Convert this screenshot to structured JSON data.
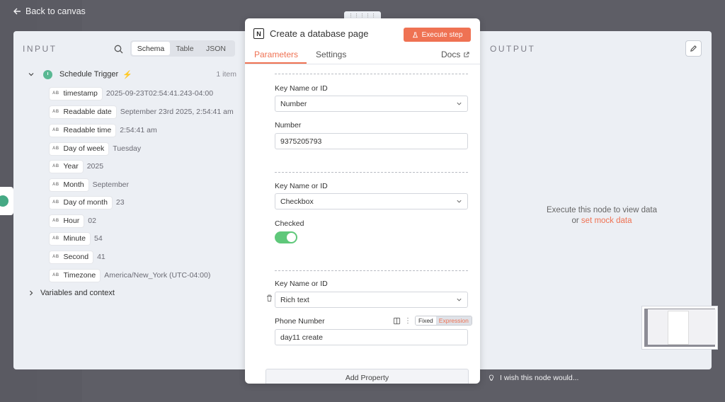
{
  "nav": {
    "back_label": "Back to canvas"
  },
  "input_panel": {
    "title": "INPUT",
    "tabs": [
      {
        "label": "Schema",
        "active": true
      },
      {
        "label": "Table",
        "active": false
      },
      {
        "label": "JSON",
        "active": false
      }
    ],
    "trigger": {
      "name": "Schedule Trigger",
      "count": "1 item"
    },
    "fields": [
      {
        "type": "AB",
        "name": "timestamp",
        "value": "2025-09-23T02:54:41.243-04:00"
      },
      {
        "type": "AB",
        "name": "Readable date",
        "value": "September 23rd 2025, 2:54:41 am"
      },
      {
        "type": "AB",
        "name": "Readable time",
        "value": "2:54:41 am"
      },
      {
        "type": "AB",
        "name": "Day of week",
        "value": "Tuesday"
      },
      {
        "type": "AB",
        "name": "Year",
        "value": "2025"
      },
      {
        "type": "AB",
        "name": "Month",
        "value": "September"
      },
      {
        "type": "AB",
        "name": "Day of month",
        "value": "23"
      },
      {
        "type": "AB",
        "name": "Hour",
        "value": "02"
      },
      {
        "type": "AB",
        "name": "Minute",
        "value": "54"
      },
      {
        "type": "AB",
        "name": "Second",
        "value": "41"
      },
      {
        "type": "AB",
        "name": "Timezone",
        "value": "America/New_York (UTC-04:00)"
      }
    ],
    "variables_label": "Variables and context"
  },
  "node": {
    "title": "Create a database page",
    "execute_label": "Execute step",
    "tabs": {
      "parameters": "Parameters",
      "settings": "Settings",
      "docs": "Docs"
    },
    "properties": [
      {
        "key_label": "Key Name or ID",
        "key_value": "Number",
        "value_label": "Number",
        "value": "9375205793"
      },
      {
        "key_label": "Key Name or ID",
        "key_value": "Checkbox",
        "value_label": "Checked",
        "checked": true
      },
      {
        "key_label": "Key Name or ID",
        "key_value": "Rich text",
        "value_label": "Phone Number",
        "value": "day11 create",
        "mode_fixed": "Fixed",
        "mode_expression": "Expression"
      }
    ],
    "add_property_label": "Add Property"
  },
  "output_panel": {
    "title": "OUTPUT",
    "empty_message": "Execute this node to view data",
    "empty_or": "or",
    "mock_link": "set mock data"
  },
  "footer": {
    "wish_label": "I wish this node would..."
  },
  "colors": {
    "accent": "#ef7253",
    "toggle_on": "#5fc87a",
    "trigger_icon": "#5ab893"
  }
}
